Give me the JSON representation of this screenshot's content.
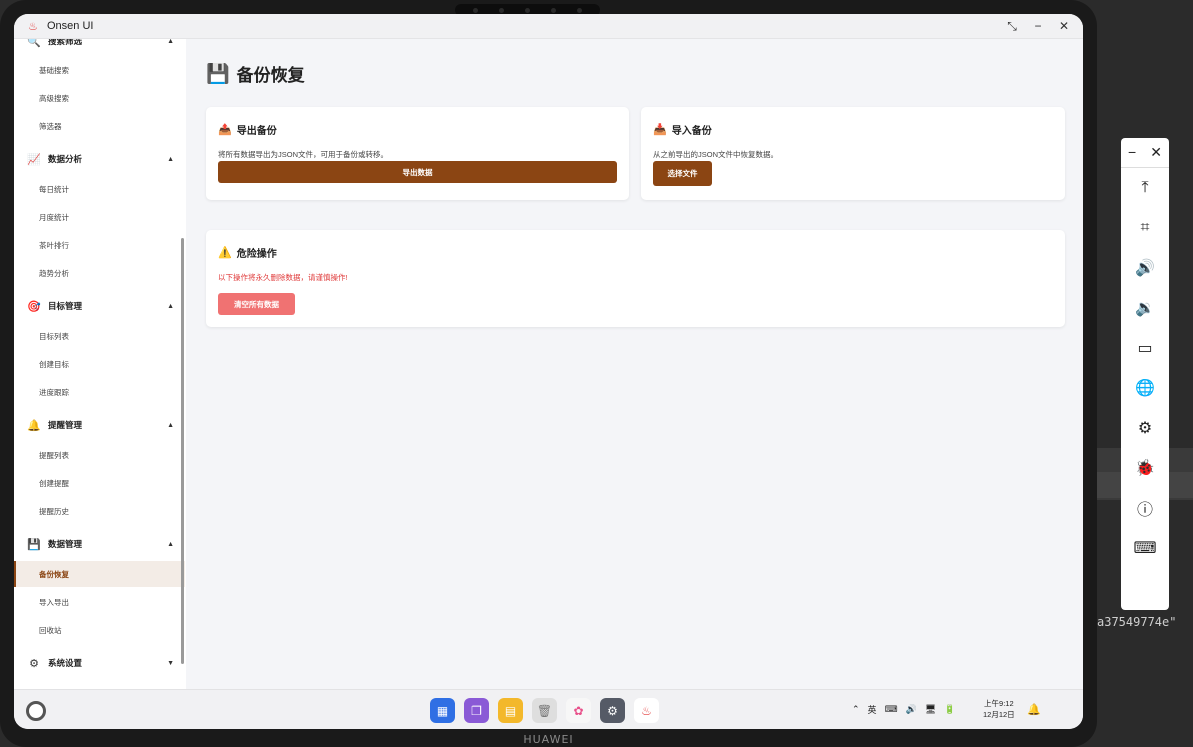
{
  "window": {
    "app_title": "Onsen UI",
    "controls": {
      "restore": "⤡",
      "minimize": "−",
      "close": "✕"
    }
  },
  "device": {
    "brand": "HUAWEI"
  },
  "sidebar": {
    "groups": [
      {
        "label": "搜索筛选",
        "icon": "search-icon",
        "glyph": "🔍",
        "arrow": "▲",
        "items": [
          "基础搜索",
          "高级搜索",
          "筛选器"
        ]
      },
      {
        "label": "数据分析",
        "icon": "chart-icon",
        "glyph": "📈",
        "arrow": "▲",
        "items": [
          "每日统计",
          "月度统计",
          "茶叶排行",
          "趋势分析"
        ]
      },
      {
        "label": "目标管理",
        "icon": "target-icon",
        "glyph": "🎯",
        "arrow": "▲",
        "items": [
          "目标列表",
          "创建目标",
          "进度跟踪"
        ]
      },
      {
        "label": "提醒管理",
        "icon": "bell-icon",
        "glyph": "🔔",
        "arrow": "▲",
        "items": [
          "提醒列表",
          "创建提醒",
          "提醒历史"
        ]
      },
      {
        "label": "数据管理",
        "icon": "floppy-disk-icon",
        "glyph": "💾",
        "arrow": "▲",
        "items": [
          "备份恢复",
          "导入导出",
          "回收站"
        ]
      },
      {
        "label": "系统设置",
        "icon": "gear-icon",
        "glyph": "⚙",
        "arrow": "▼",
        "items": []
      }
    ],
    "active_item": "备份恢复"
  },
  "main": {
    "title": "备份恢复",
    "title_icon": "💾",
    "export_card": {
      "icon": "📤",
      "title": "导出备份",
      "description": "将所有数据导出为JSON文件，可用于备份或转移。",
      "button": "导出数据"
    },
    "import_card": {
      "icon": "📥",
      "title": "导入备份",
      "description": "从之前导出的JSON文件中恢复数据。",
      "button": "选择文件"
    },
    "danger_card": {
      "icon": "⚠️",
      "title": "危险操作",
      "warning": "以下操作将永久删除数据，请谨慎操作!",
      "button": "清空所有数据"
    }
  },
  "taskbar": {
    "clock_time": "上午9:12",
    "clock_date": "12月12日",
    "dock_apps": [
      {
        "name": "app-grid-icon",
        "color": "#2f6fe4"
      },
      {
        "name": "multi-window-icon",
        "color": "#8a5ad6"
      },
      {
        "name": "notes-icon",
        "color": "#f3b82b"
      },
      {
        "name": "trash-icon",
        "color": "#9a9a9a"
      },
      {
        "name": "photos-icon",
        "color": "#f0f0f0"
      },
      {
        "name": "settings-icon",
        "color": "#555a66"
      },
      {
        "name": "onsen-app-icon",
        "color": "#ffffff"
      }
    ],
    "tray": [
      "⌃",
      "英",
      "⌨",
      "🔊",
      "🖥",
      "🔋"
    ]
  },
  "float_toolbar": {
    "top": [
      "−",
      "✕"
    ],
    "items": [
      {
        "name": "scroll-top-icon",
        "glyph": "⤒"
      },
      {
        "name": "crop-icon",
        "glyph": "⌗"
      },
      {
        "name": "volume-up-icon",
        "glyph": "🔊"
      },
      {
        "name": "volume-down-icon",
        "glyph": "🔉"
      },
      {
        "name": "battery-icon",
        "glyph": "▭"
      },
      {
        "name": "globe-icon",
        "glyph": "🌐"
      },
      {
        "name": "settings-icon",
        "glyph": "⚙"
      },
      {
        "name": "bug-icon",
        "glyph": "🐞"
      },
      {
        "name": "info-icon",
        "glyph": "ⓘ"
      },
      {
        "name": "keyboard-icon",
        "glyph": "⌨"
      }
    ]
  },
  "background_text": "a37549774e\""
}
